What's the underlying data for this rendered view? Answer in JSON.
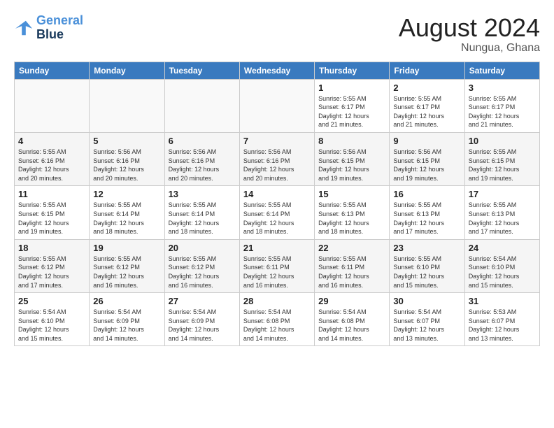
{
  "logo": {
    "line1": "General",
    "line2": "Blue"
  },
  "title": "August 2024",
  "location": "Nungua, Ghana",
  "headers": [
    "Sunday",
    "Monday",
    "Tuesday",
    "Wednesday",
    "Thursday",
    "Friday",
    "Saturday"
  ],
  "weeks": [
    [
      {
        "day": "",
        "info": ""
      },
      {
        "day": "",
        "info": ""
      },
      {
        "day": "",
        "info": ""
      },
      {
        "day": "",
        "info": ""
      },
      {
        "day": "1",
        "info": "Sunrise: 5:55 AM\nSunset: 6:17 PM\nDaylight: 12 hours\nand 21 minutes."
      },
      {
        "day": "2",
        "info": "Sunrise: 5:55 AM\nSunset: 6:17 PM\nDaylight: 12 hours\nand 21 minutes."
      },
      {
        "day": "3",
        "info": "Sunrise: 5:55 AM\nSunset: 6:17 PM\nDaylight: 12 hours\nand 21 minutes."
      }
    ],
    [
      {
        "day": "4",
        "info": "Sunrise: 5:55 AM\nSunset: 6:16 PM\nDaylight: 12 hours\nand 20 minutes."
      },
      {
        "day": "5",
        "info": "Sunrise: 5:56 AM\nSunset: 6:16 PM\nDaylight: 12 hours\nand 20 minutes."
      },
      {
        "day": "6",
        "info": "Sunrise: 5:56 AM\nSunset: 6:16 PM\nDaylight: 12 hours\nand 20 minutes."
      },
      {
        "day": "7",
        "info": "Sunrise: 5:56 AM\nSunset: 6:16 PM\nDaylight: 12 hours\nand 20 minutes."
      },
      {
        "day": "8",
        "info": "Sunrise: 5:56 AM\nSunset: 6:15 PM\nDaylight: 12 hours\nand 19 minutes."
      },
      {
        "day": "9",
        "info": "Sunrise: 5:56 AM\nSunset: 6:15 PM\nDaylight: 12 hours\nand 19 minutes."
      },
      {
        "day": "10",
        "info": "Sunrise: 5:55 AM\nSunset: 6:15 PM\nDaylight: 12 hours\nand 19 minutes."
      }
    ],
    [
      {
        "day": "11",
        "info": "Sunrise: 5:55 AM\nSunset: 6:15 PM\nDaylight: 12 hours\nand 19 minutes."
      },
      {
        "day": "12",
        "info": "Sunrise: 5:55 AM\nSunset: 6:14 PM\nDaylight: 12 hours\nand 18 minutes."
      },
      {
        "day": "13",
        "info": "Sunrise: 5:55 AM\nSunset: 6:14 PM\nDaylight: 12 hours\nand 18 minutes."
      },
      {
        "day": "14",
        "info": "Sunrise: 5:55 AM\nSunset: 6:14 PM\nDaylight: 12 hours\nand 18 minutes."
      },
      {
        "day": "15",
        "info": "Sunrise: 5:55 AM\nSunset: 6:13 PM\nDaylight: 12 hours\nand 18 minutes."
      },
      {
        "day": "16",
        "info": "Sunrise: 5:55 AM\nSunset: 6:13 PM\nDaylight: 12 hours\nand 17 minutes."
      },
      {
        "day": "17",
        "info": "Sunrise: 5:55 AM\nSunset: 6:13 PM\nDaylight: 12 hours\nand 17 minutes."
      }
    ],
    [
      {
        "day": "18",
        "info": "Sunrise: 5:55 AM\nSunset: 6:12 PM\nDaylight: 12 hours\nand 17 minutes."
      },
      {
        "day": "19",
        "info": "Sunrise: 5:55 AM\nSunset: 6:12 PM\nDaylight: 12 hours\nand 16 minutes."
      },
      {
        "day": "20",
        "info": "Sunrise: 5:55 AM\nSunset: 6:12 PM\nDaylight: 12 hours\nand 16 minutes."
      },
      {
        "day": "21",
        "info": "Sunrise: 5:55 AM\nSunset: 6:11 PM\nDaylight: 12 hours\nand 16 minutes."
      },
      {
        "day": "22",
        "info": "Sunrise: 5:55 AM\nSunset: 6:11 PM\nDaylight: 12 hours\nand 16 minutes."
      },
      {
        "day": "23",
        "info": "Sunrise: 5:55 AM\nSunset: 6:10 PM\nDaylight: 12 hours\nand 15 minutes."
      },
      {
        "day": "24",
        "info": "Sunrise: 5:54 AM\nSunset: 6:10 PM\nDaylight: 12 hours\nand 15 minutes."
      }
    ],
    [
      {
        "day": "25",
        "info": "Sunrise: 5:54 AM\nSunset: 6:10 PM\nDaylight: 12 hours\nand 15 minutes."
      },
      {
        "day": "26",
        "info": "Sunrise: 5:54 AM\nSunset: 6:09 PM\nDaylight: 12 hours\nand 14 minutes."
      },
      {
        "day": "27",
        "info": "Sunrise: 5:54 AM\nSunset: 6:09 PM\nDaylight: 12 hours\nand 14 minutes."
      },
      {
        "day": "28",
        "info": "Sunrise: 5:54 AM\nSunset: 6:08 PM\nDaylight: 12 hours\nand 14 minutes."
      },
      {
        "day": "29",
        "info": "Sunrise: 5:54 AM\nSunset: 6:08 PM\nDaylight: 12 hours\nand 14 minutes."
      },
      {
        "day": "30",
        "info": "Sunrise: 5:54 AM\nSunset: 6:07 PM\nDaylight: 12 hours\nand 13 minutes."
      },
      {
        "day": "31",
        "info": "Sunrise: 5:53 AM\nSunset: 6:07 PM\nDaylight: 12 hours\nand 13 minutes."
      }
    ]
  ]
}
